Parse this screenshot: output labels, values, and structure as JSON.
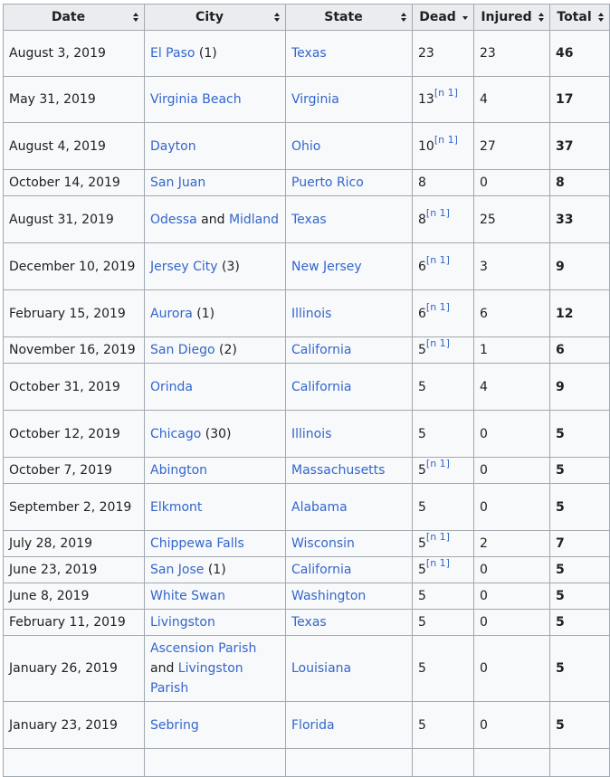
{
  "headers": [
    "Date",
    "City",
    "State",
    "Dead",
    "Injured",
    "Total"
  ],
  "ref_label": "[n 1]",
  "rows": [
    {
      "date": "August 3, 2019",
      "city": [
        "El Paso"
      ],
      "city_join": "",
      "city_note": "(1)",
      "state": "Texas",
      "dead": "23",
      "ref": false,
      "injured": "23",
      "total": "46"
    },
    {
      "date": "May 31, 2019",
      "city": [
        "Virginia Beach"
      ],
      "city_join": "",
      "city_note": "",
      "state": "Virginia",
      "dead": "13",
      "ref": true,
      "injured": "4",
      "total": "17"
    },
    {
      "date": "August 4, 2019",
      "city": [
        "Dayton"
      ],
      "city_join": "",
      "city_note": "",
      "state": "Ohio",
      "dead": "10",
      "ref": true,
      "injured": "27",
      "total": "37"
    },
    {
      "date": "October 14, 2019",
      "city": [
        "San Juan"
      ],
      "city_join": "",
      "city_note": "",
      "state": "Puerto Rico",
      "dead": "8",
      "ref": false,
      "injured": "0",
      "total": "8"
    },
    {
      "date": "August 31, 2019",
      "city": [
        "Odessa",
        "Midland"
      ],
      "city_join": "and",
      "city_note": "",
      "state": "Texas",
      "dead": "8",
      "ref": true,
      "injured": "25",
      "total": "33"
    },
    {
      "date": "December 10, 2019",
      "city": [
        "Jersey City"
      ],
      "city_join": "",
      "city_note": "(3)",
      "state": "New Jersey",
      "dead": "6",
      "ref": true,
      "injured": "3",
      "total": "9"
    },
    {
      "date": "February 15, 2019",
      "city": [
        "Aurora"
      ],
      "city_join": "",
      "city_note": "(1)",
      "state": "Illinois",
      "dead": "6",
      "ref": true,
      "injured": "6",
      "total": "12"
    },
    {
      "date": "November 16, 2019",
      "city": [
        "San Diego"
      ],
      "city_join": "",
      "city_note": "(2)",
      "state": "California",
      "dead": "5",
      "ref": true,
      "injured": "1",
      "total": "6"
    },
    {
      "date": "October 31, 2019",
      "city": [
        "Orinda"
      ],
      "city_join": "",
      "city_note": "",
      "state": "California",
      "dead": "5",
      "ref": false,
      "injured": "4",
      "total": "9"
    },
    {
      "date": "October 12, 2019",
      "city": [
        "Chicago"
      ],
      "city_join": "",
      "city_note": "(30)",
      "state": "Illinois",
      "dead": "5",
      "ref": false,
      "injured": "0",
      "total": "5"
    },
    {
      "date": "October 7, 2019",
      "city": [
        "Abington"
      ],
      "city_join": "",
      "city_note": "",
      "state": "Massachusetts",
      "dead": "5",
      "ref": true,
      "injured": "0",
      "total": "5"
    },
    {
      "date": "September 2, 2019",
      "city": [
        "Elkmont"
      ],
      "city_join": "",
      "city_note": "",
      "state": "Alabama",
      "dead": "5",
      "ref": false,
      "injured": "0",
      "total": "5"
    },
    {
      "date": "July 28, 2019",
      "city": [
        "Chippewa Falls"
      ],
      "city_join": "",
      "city_note": "",
      "state": "Wisconsin",
      "dead": "5",
      "ref": true,
      "injured": "2",
      "total": "7"
    },
    {
      "date": "June 23, 2019",
      "city": [
        "San Jose"
      ],
      "city_join": "",
      "city_note": "(1)",
      "state": "California",
      "dead": "5",
      "ref": true,
      "injured": "0",
      "total": "5"
    },
    {
      "date": "June 8, 2019",
      "city": [
        "White Swan"
      ],
      "city_join": "",
      "city_note": "",
      "state": "Washington",
      "dead": "5",
      "ref": false,
      "injured": "0",
      "total": "5"
    },
    {
      "date": "February 11, 2019",
      "city": [
        "Livingston"
      ],
      "city_join": "",
      "city_note": "",
      "state": "Texas",
      "dead": "5",
      "ref": false,
      "injured": "0",
      "total": "5"
    },
    {
      "date": "January 26, 2019",
      "city": [
        "Ascension Parish",
        "Livingston Parish"
      ],
      "city_join": "and",
      "city_note": "",
      "state": "Louisiana",
      "dead": "5",
      "ref": false,
      "injured": "0",
      "total": "5"
    },
    {
      "date": "January 23, 2019",
      "city": [
        "Sebring"
      ],
      "city_join": "",
      "city_note": "",
      "state": "Florida",
      "dead": "5",
      "ref": false,
      "injured": "0",
      "total": "5"
    },
    {
      "date": "",
      "city": [
        ""
      ],
      "city_join": "",
      "city_note": "",
      "state": "",
      "dead": "",
      "ref": false,
      "injured": "",
      "total": ""
    }
  ],
  "colors": {
    "link": "#3366cc",
    "header_bg": "#eaecf0",
    "cell_bg": "#f8f9fa",
    "border": "#a2a9b1"
  }
}
